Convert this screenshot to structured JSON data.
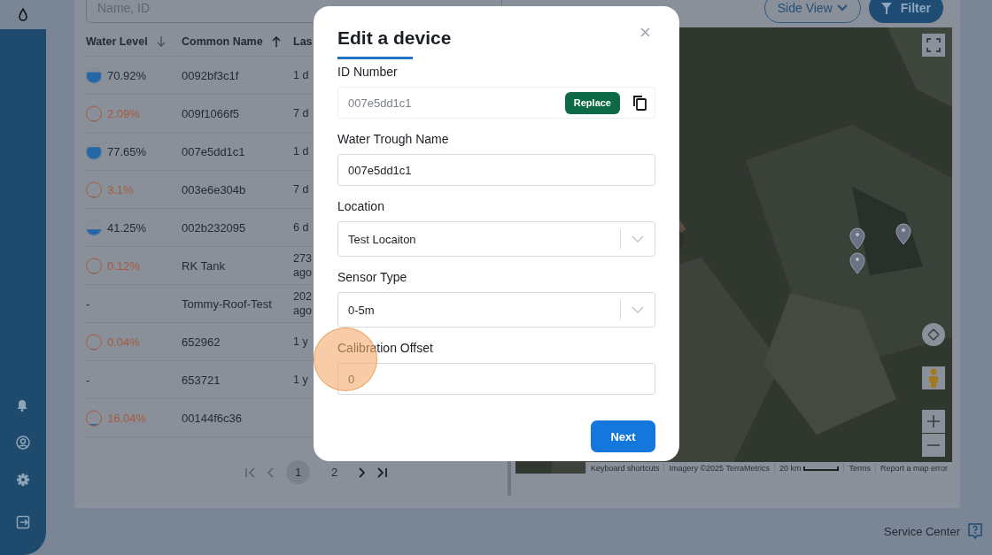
{
  "search": {
    "placeholder": "Name, ID"
  },
  "toolbar": {
    "view_button": "Side View",
    "filter_button": "Filter"
  },
  "table": {
    "columns": [
      {
        "label": "Water Level",
        "sorted": true,
        "descending": true
      },
      {
        "label": "Common Name",
        "sorted": true,
        "descending": false
      },
      {
        "label": "Las",
        "sorted": false
      }
    ],
    "rows": [
      {
        "kind": "gauge",
        "level": 0.7092,
        "alert": false,
        "reading": "70.92%",
        "name": "0092bf3c1f",
        "last": "1 d"
      },
      {
        "kind": "gauge",
        "level": 0.0209,
        "alert": true,
        "reading": "2.09%",
        "name": "009f1066f5",
        "last": "7 d"
      },
      {
        "kind": "gauge",
        "level": 0.7765,
        "alert": false,
        "reading": "77.65%",
        "name": "007e5dd1c1",
        "last": "1 d"
      },
      {
        "kind": "gauge",
        "level": 0.031,
        "alert": true,
        "reading": "3.1%",
        "name": "003e6e304b",
        "last": "7 d"
      },
      {
        "kind": "gauge",
        "level": 0.4125,
        "alert": false,
        "reading": "41.25%",
        "name": "002b232095",
        "last": "6 d"
      },
      {
        "kind": "gauge",
        "level": 0.0012,
        "alert": true,
        "reading": "0.12%",
        "name": "RK Tank",
        "last": "273\nago"
      },
      {
        "kind": "blank",
        "reading": "-",
        "name": "Tommy-Roof-Test",
        "last": "202\nago"
      },
      {
        "kind": "gauge",
        "level": 0.0004,
        "alert": true,
        "reading": "0.04%",
        "name": "652962",
        "last": "1 y"
      },
      {
        "kind": "blank",
        "reading": "-",
        "name": "653721",
        "last": "1 y"
      },
      {
        "kind": "gauge",
        "level": 0.1604,
        "alert": true,
        "reading": "16.04%",
        "name": "00144f6c36"
      }
    ]
  },
  "pagination": {
    "pages": [
      {
        "label": "1",
        "selected": true
      },
      {
        "label": "2",
        "selected": false
      }
    ]
  },
  "map": {
    "attribution": [
      "Keyboard shortcuts",
      "Imagery ©2025 TerraMetrics",
      "Terms",
      "Report a map error"
    ],
    "scale": "20 km"
  },
  "modal": {
    "title": "Edit a device",
    "fields": [
      {
        "kind": "readonly",
        "label": "ID Number",
        "value": "007e5dd1c1",
        "button": "Replace"
      },
      {
        "kind": "text",
        "label": "Water Trough Name",
        "value": "007e5dd1c1"
      },
      {
        "kind": "select",
        "label": "Location",
        "value": "Test Locaiton"
      },
      {
        "kind": "select",
        "label": "Sensor Type",
        "value": "0-5m"
      },
      {
        "kind": "text",
        "label": "Calibration Offset",
        "value": "0"
      }
    ],
    "primary_button": "Next"
  },
  "footer": {
    "service_center": "Service Center"
  }
}
